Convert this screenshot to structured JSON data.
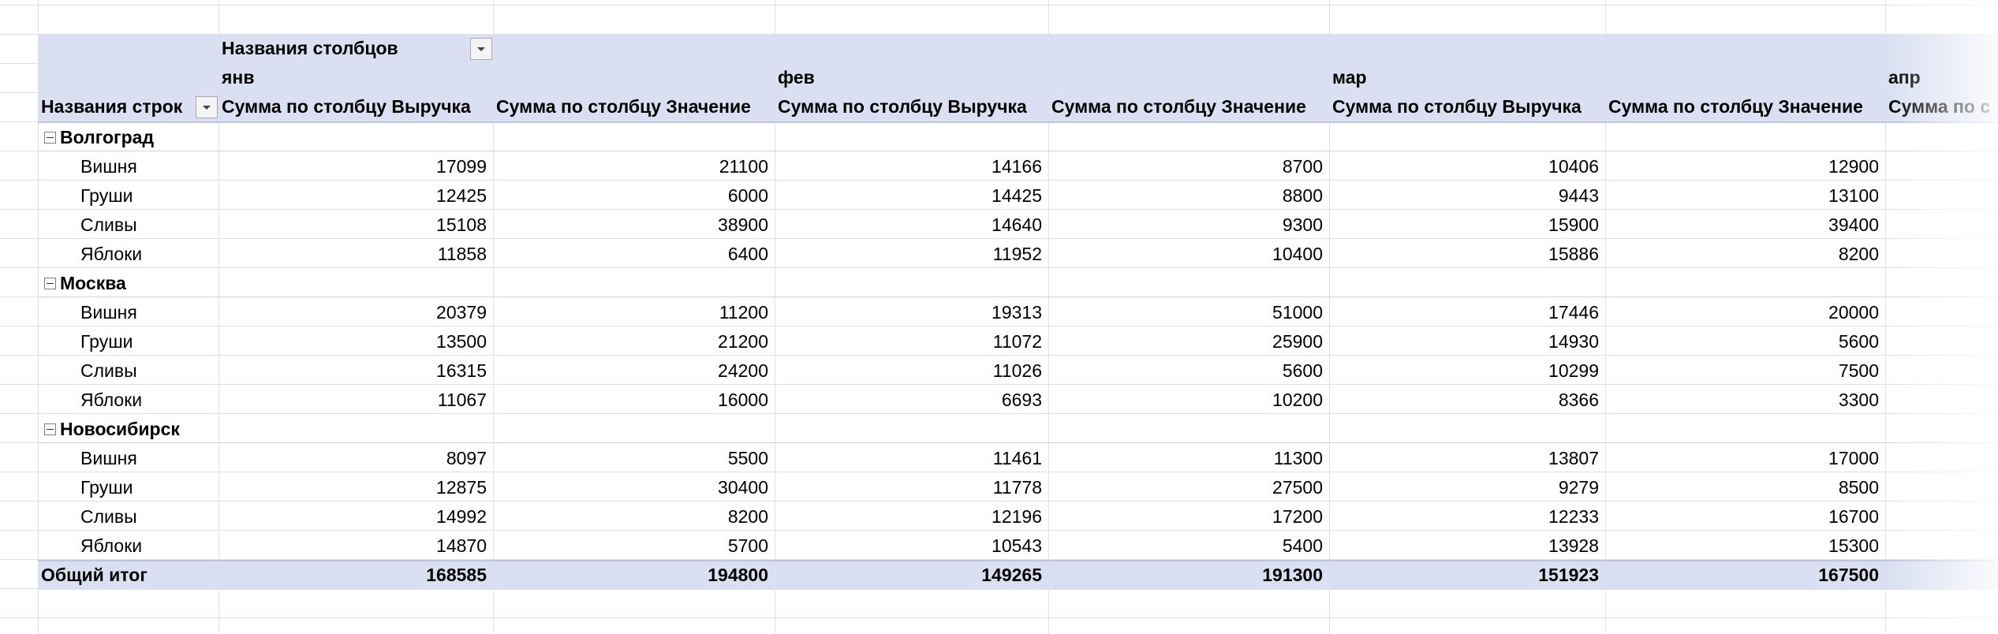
{
  "pivot": {
    "column_field_label": "Названия столбцов",
    "row_field_label": "Названия строк",
    "grand_total_label": "Общий итог",
    "months": [
      "янв",
      "фев",
      "мар",
      "апр"
    ],
    "measures": [
      "Сумма по столбцу Выручка",
      "Сумма по столбцу Значение"
    ],
    "value_headers": [
      "Сумма по столбцу Выручка",
      "Сумма по столбцу Значение",
      "Сумма по столбцу Выручка",
      "Сумма по столбцу Значение",
      "Сумма по столбцу Выручка",
      "Сумма по столбцу Значение",
      "Сумма по с"
    ],
    "groups": [
      {
        "name": "Волгоград",
        "rows": [
          {
            "label": "Вишня",
            "values": [
              "17099",
              "21100",
              "14166",
              "8700",
              "10406",
              "12900"
            ]
          },
          {
            "label": "Груши",
            "values": [
              "12425",
              "6000",
              "14425",
              "8800",
              "9443",
              "13100"
            ]
          },
          {
            "label": "Сливы",
            "values": [
              "15108",
              "38900",
              "14640",
              "9300",
              "15900",
              "39400"
            ]
          },
          {
            "label": "Яблоки",
            "values": [
              "11858",
              "6400",
              "11952",
              "10400",
              "15886",
              "8200"
            ]
          }
        ]
      },
      {
        "name": "Москва",
        "rows": [
          {
            "label": "Вишня",
            "values": [
              "20379",
              "11200",
              "19313",
              "51000",
              "17446",
              "20000"
            ]
          },
          {
            "label": "Груши",
            "values": [
              "13500",
              "21200",
              "11072",
              "25900",
              "14930",
              "5600"
            ]
          },
          {
            "label": "Сливы",
            "values": [
              "16315",
              "24200",
              "11026",
              "5600",
              "10299",
              "7500"
            ]
          },
          {
            "label": "Яблоки",
            "values": [
              "11067",
              "16000",
              "6693",
              "10200",
              "8366",
              "3300"
            ]
          }
        ]
      },
      {
        "name": "Новосибирск",
        "rows": [
          {
            "label": "Вишня",
            "values": [
              "8097",
              "5500",
              "11461",
              "11300",
              "13807",
              "17000"
            ]
          },
          {
            "label": "Груши",
            "values": [
              "12875",
              "30400",
              "11778",
              "27500",
              "9279",
              "8500"
            ]
          },
          {
            "label": "Сливы",
            "values": [
              "14992",
              "8200",
              "12196",
              "17200",
              "12233",
              "16700"
            ]
          },
          {
            "label": "Яблоки",
            "values": [
              "14870",
              "5700",
              "10543",
              "5400",
              "13928",
              "15300"
            ]
          }
        ]
      }
    ],
    "grand_total": [
      "168585",
      "194800",
      "149265",
      "191300",
      "151923",
      "167500"
    ]
  },
  "icons": {
    "filter_dropdown": "chevron-down-icon",
    "collapse": "minus-box-icon"
  },
  "colors": {
    "header_band": "#dae0f1",
    "separator": "#bcc6e2",
    "gridline": "#e1e1e1"
  }
}
